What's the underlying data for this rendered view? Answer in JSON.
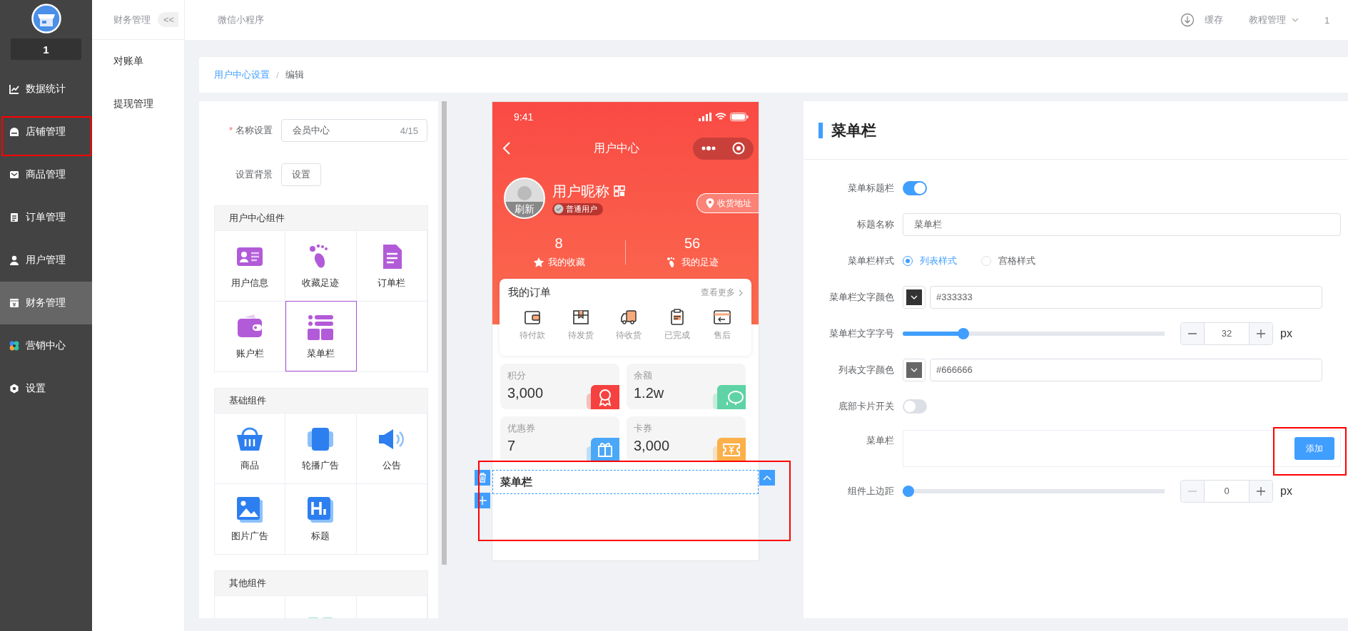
{
  "sidebar": {
    "badge": "1",
    "items": [
      {
        "label": "数据统计",
        "selected": false
      },
      {
        "label": "店铺管理",
        "selected": false
      },
      {
        "label": "商品管理",
        "selected": false
      },
      {
        "label": "订单管理",
        "selected": false
      },
      {
        "label": "用户管理",
        "selected": false
      },
      {
        "label": "财务管理",
        "selected": true
      },
      {
        "label": "营销中心",
        "selected": false
      },
      {
        "label": "设置",
        "selected": false
      }
    ]
  },
  "sub_nav": {
    "title": "财务管理",
    "collapse_button": "<<",
    "items": [
      {
        "label": "对账单"
      },
      {
        "label": "提现管理"
      }
    ]
  },
  "top_bar": {
    "title": "微信小程序",
    "cache_button": "缓存",
    "tutorial_menu": "教程管理",
    "user": "1"
  },
  "breadcrumb": {
    "items": [
      "用户中心设置",
      "编辑"
    ],
    "separator": "/"
  },
  "editor": {
    "name_field": {
      "required_mark": "*",
      "label": "名称设置",
      "value": "会员中心",
      "counter": "4/15"
    },
    "background": {
      "label": "设置背景",
      "button": "设置"
    },
    "groups": [
      {
        "title": "用户中心组件",
        "items": [
          {
            "label": "用户信息",
            "selected": false
          },
          {
            "label": "收藏足迹",
            "selected": false
          },
          {
            "label": "订单栏",
            "selected": false
          },
          {
            "label": "账户栏",
            "selected": false
          },
          {
            "label": "菜单栏",
            "selected": true
          }
        ]
      },
      {
        "title": "基础组件",
        "items": [
          {
            "label": "商品",
            "selected": false
          },
          {
            "label": "轮播广告",
            "selected": false
          },
          {
            "label": "公告",
            "selected": false
          },
          {
            "label": "图片广告",
            "selected": false
          },
          {
            "label": "标题",
            "selected": false
          }
        ]
      },
      {
        "title": "其他组件"
      }
    ]
  },
  "phone": {
    "status_time": "9:41",
    "nav_title": "用户中心",
    "user": {
      "avatar_label": "刷新",
      "nickname": "用户昵称",
      "level": "普通用户",
      "address_button": "收货地址"
    },
    "stats": [
      {
        "value": "8",
        "label": "我的收藏"
      },
      {
        "value": "56",
        "label": "我的足迹"
      }
    ],
    "orders": {
      "title": "我的订单",
      "more": "查看更多",
      "items": [
        "待付款",
        "待发货",
        "待收货",
        "已完成",
        "售后"
      ]
    },
    "assets": [
      {
        "label": "积分",
        "value": "3,000",
        "color": "#f5413f"
      },
      {
        "label": "余额",
        "value": "1.2w",
        "color": "#5fd3a6"
      },
      {
        "label": "优惠券",
        "value": "7",
        "color": "#4aa8f7"
      },
      {
        "label": "卡券",
        "value": "3,000",
        "color": "#fbb04a"
      }
    ],
    "menu_block": {
      "title": "菜单栏"
    }
  },
  "settings": {
    "title": "菜单栏",
    "fields": [
      {
        "kind": "switch",
        "label": "菜单标题栏",
        "on": true
      },
      {
        "kind": "text",
        "label": "标题名称",
        "value": "菜单栏"
      },
      {
        "kind": "radio",
        "label": "菜单栏样式",
        "options": [
          {
            "label": "列表样式",
            "selected": true
          },
          {
            "label": "宫格样式",
            "selected": false
          }
        ]
      },
      {
        "kind": "color",
        "label": "菜单栏文字颜色",
        "value": "#333333"
      },
      {
        "kind": "slider",
        "label": "菜单栏文字字号",
        "level": 0.22,
        "value": "32",
        "unit": "px",
        "decrement_disabled": false
      },
      {
        "kind": "color",
        "label": "列表文字颜色",
        "value": "#666666"
      },
      {
        "kind": "switch",
        "label": "底部卡片开关",
        "on": false
      },
      {
        "kind": "list",
        "label": "菜单栏",
        "button": "添加"
      },
      {
        "kind": "slider",
        "label": "组件上边距",
        "level": 0,
        "value": "0",
        "unit": "px",
        "decrement_disabled": true
      }
    ]
  }
}
